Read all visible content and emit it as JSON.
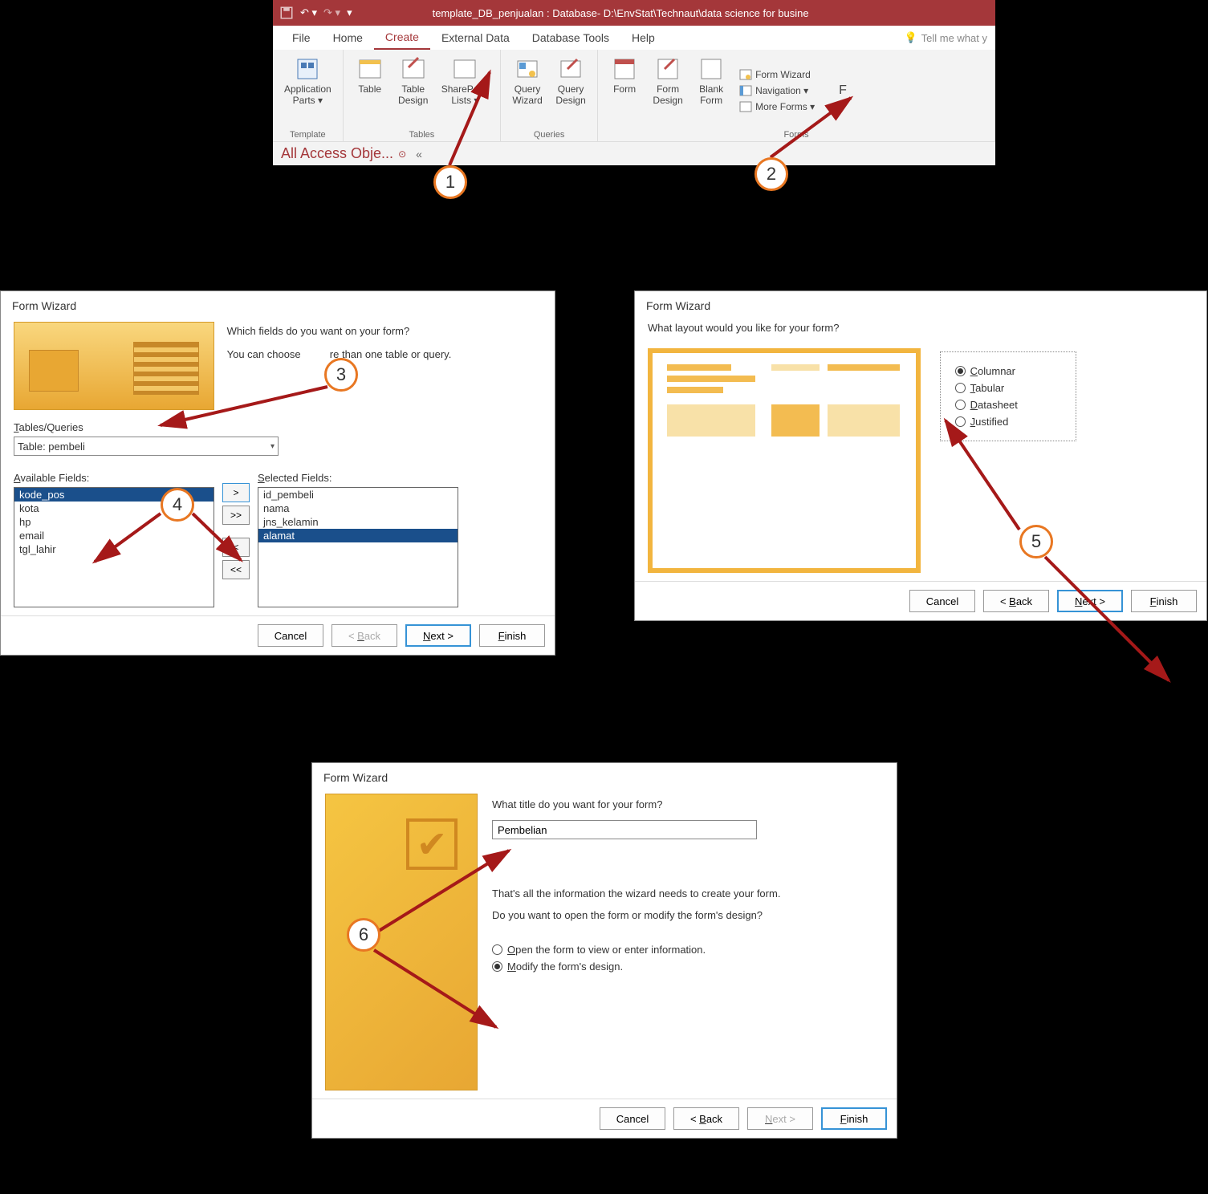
{
  "titlebar": {
    "title": "template_DB_penjualan : Database- D:\\EnvStat\\Technaut\\data science for busine"
  },
  "menu": {
    "items": [
      "File",
      "Home",
      "Create",
      "External Data",
      "Database Tools",
      "Help"
    ],
    "active": "Create",
    "tellme": "Tell me what y"
  },
  "ribbon": {
    "templates": {
      "title": "Template",
      "appParts": "Application\nParts ▾"
    },
    "tables": {
      "title": "Tables",
      "table": "Table",
      "tableDesign": "Table\nDesign",
      "sharepoint": "SharePoint\nLists ▾"
    },
    "queries": {
      "title": "Queries",
      "qwizard": "Query\nWizard",
      "qdesign": "Query\nDesign"
    },
    "forms": {
      "title": "Forms",
      "form": "Form",
      "formDesign": "Form\nDesign",
      "blank": "Blank\nForm",
      "formWizard": "Form Wizard",
      "nav": "Navigation ▾",
      "more": "More Forms ▾"
    }
  },
  "navpane": {
    "title": "All Access Obje..."
  },
  "wiz1": {
    "title": "Form Wizard",
    "q": "Which fields do you want on your form?",
    "hint_a": "You can choose",
    "hint_b": "re than one table or query.",
    "tqLabel": "Tables/Queries",
    "tableSel": "Table: pembeli",
    "availLabel": "Available Fields:",
    "selLabel": "Selected Fields:",
    "avail": [
      "kode_pos",
      "kota",
      "hp",
      "email",
      "tgl_lahir"
    ],
    "selected": [
      "id_pembeli",
      "nama",
      "jns_kelamin",
      "alamat"
    ],
    "availSel": "kode_pos",
    "selSel": "alamat",
    "btnCancel": "Cancel",
    "btnBack": "< Back",
    "btnNext": "Next >",
    "btnFinish": "Finish"
  },
  "wiz2": {
    "title": "Form Wizard",
    "q": "What layout would you like for your form?",
    "opts": [
      "Columnar",
      "Tabular",
      "Datasheet",
      "Justified"
    ],
    "selected": "Columnar",
    "btnCancel": "Cancel",
    "btnBack": "< Back",
    "btnNext": "Next >",
    "btnFinish": "Finish"
  },
  "wiz3": {
    "title": "Form Wizard",
    "q": "What title do you want for your form?",
    "titleVal": "Pembelian",
    "info1": "That's all the information the wizard needs to create your form.",
    "info2": "Do you want to open the form or modify the form's design?",
    "optOpen": "Open the form to view or enter information.",
    "optModify": "Modify the form's design.",
    "selected": "modify",
    "btnCancel": "Cancel",
    "btnBack": "< Back",
    "btnNext": "Next >",
    "btnFinish": "Finish"
  },
  "callouts": {
    "c1": "1",
    "c2": "2",
    "c3": "3",
    "c4": "4",
    "c5": "5",
    "c6": "6"
  }
}
